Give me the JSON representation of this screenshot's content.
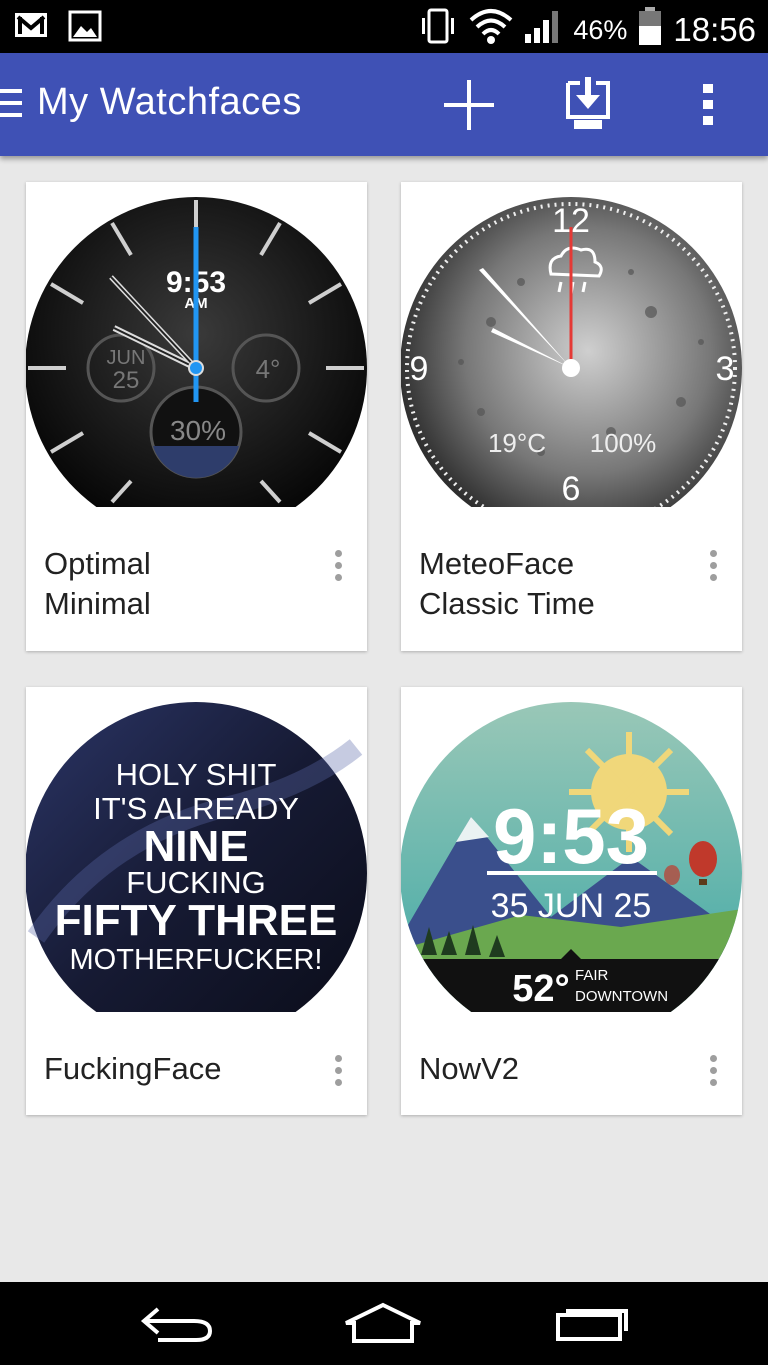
{
  "status_bar": {
    "battery_percent": "46%",
    "time": "18:56",
    "icons": [
      "gmail-icon",
      "gallery-icon",
      "vibrate-icon",
      "wifi-icon",
      "signal-icon",
      "battery-icon"
    ]
  },
  "app_bar": {
    "title": "My Watchfaces",
    "actions": [
      "add-icon",
      "install-to-watch-icon",
      "overflow-menu-icon"
    ],
    "color": "#3f51b5"
  },
  "cards": [
    {
      "name": "Optimal\nMinimal",
      "face": {
        "time": "9:53",
        "ampm": "AM",
        "month": "JUN",
        "day": "25",
        "temp": "4°",
        "percent": "30%",
        "percent_fill": 0.3
      }
    },
    {
      "name": "MeteoFace\nClassic Time",
      "face": {
        "n12": "12",
        "n3": "3",
        "n6": "6",
        "n9": "9",
        "temp": "19°C",
        "humidity": "100%"
      }
    },
    {
      "name": "FuckingFace",
      "face": {
        "l1": "HOLY SHIT",
        "l2": "IT'S ALREADY",
        "l3": "NINE",
        "l4": "FUCKING",
        "l5": "FIFTY THREE",
        "l6": "MOTHERFUCKER!"
      }
    },
    {
      "name": "NowV2",
      "face": {
        "time": "9:53",
        "date": "35 JUN 25",
        "temp": "52°",
        "cond1": "FAIR",
        "cond2": "DOWNTOWN"
      }
    }
  ],
  "nav_bar": {
    "buttons": [
      "back-icon",
      "home-icon",
      "recents-icon"
    ]
  }
}
